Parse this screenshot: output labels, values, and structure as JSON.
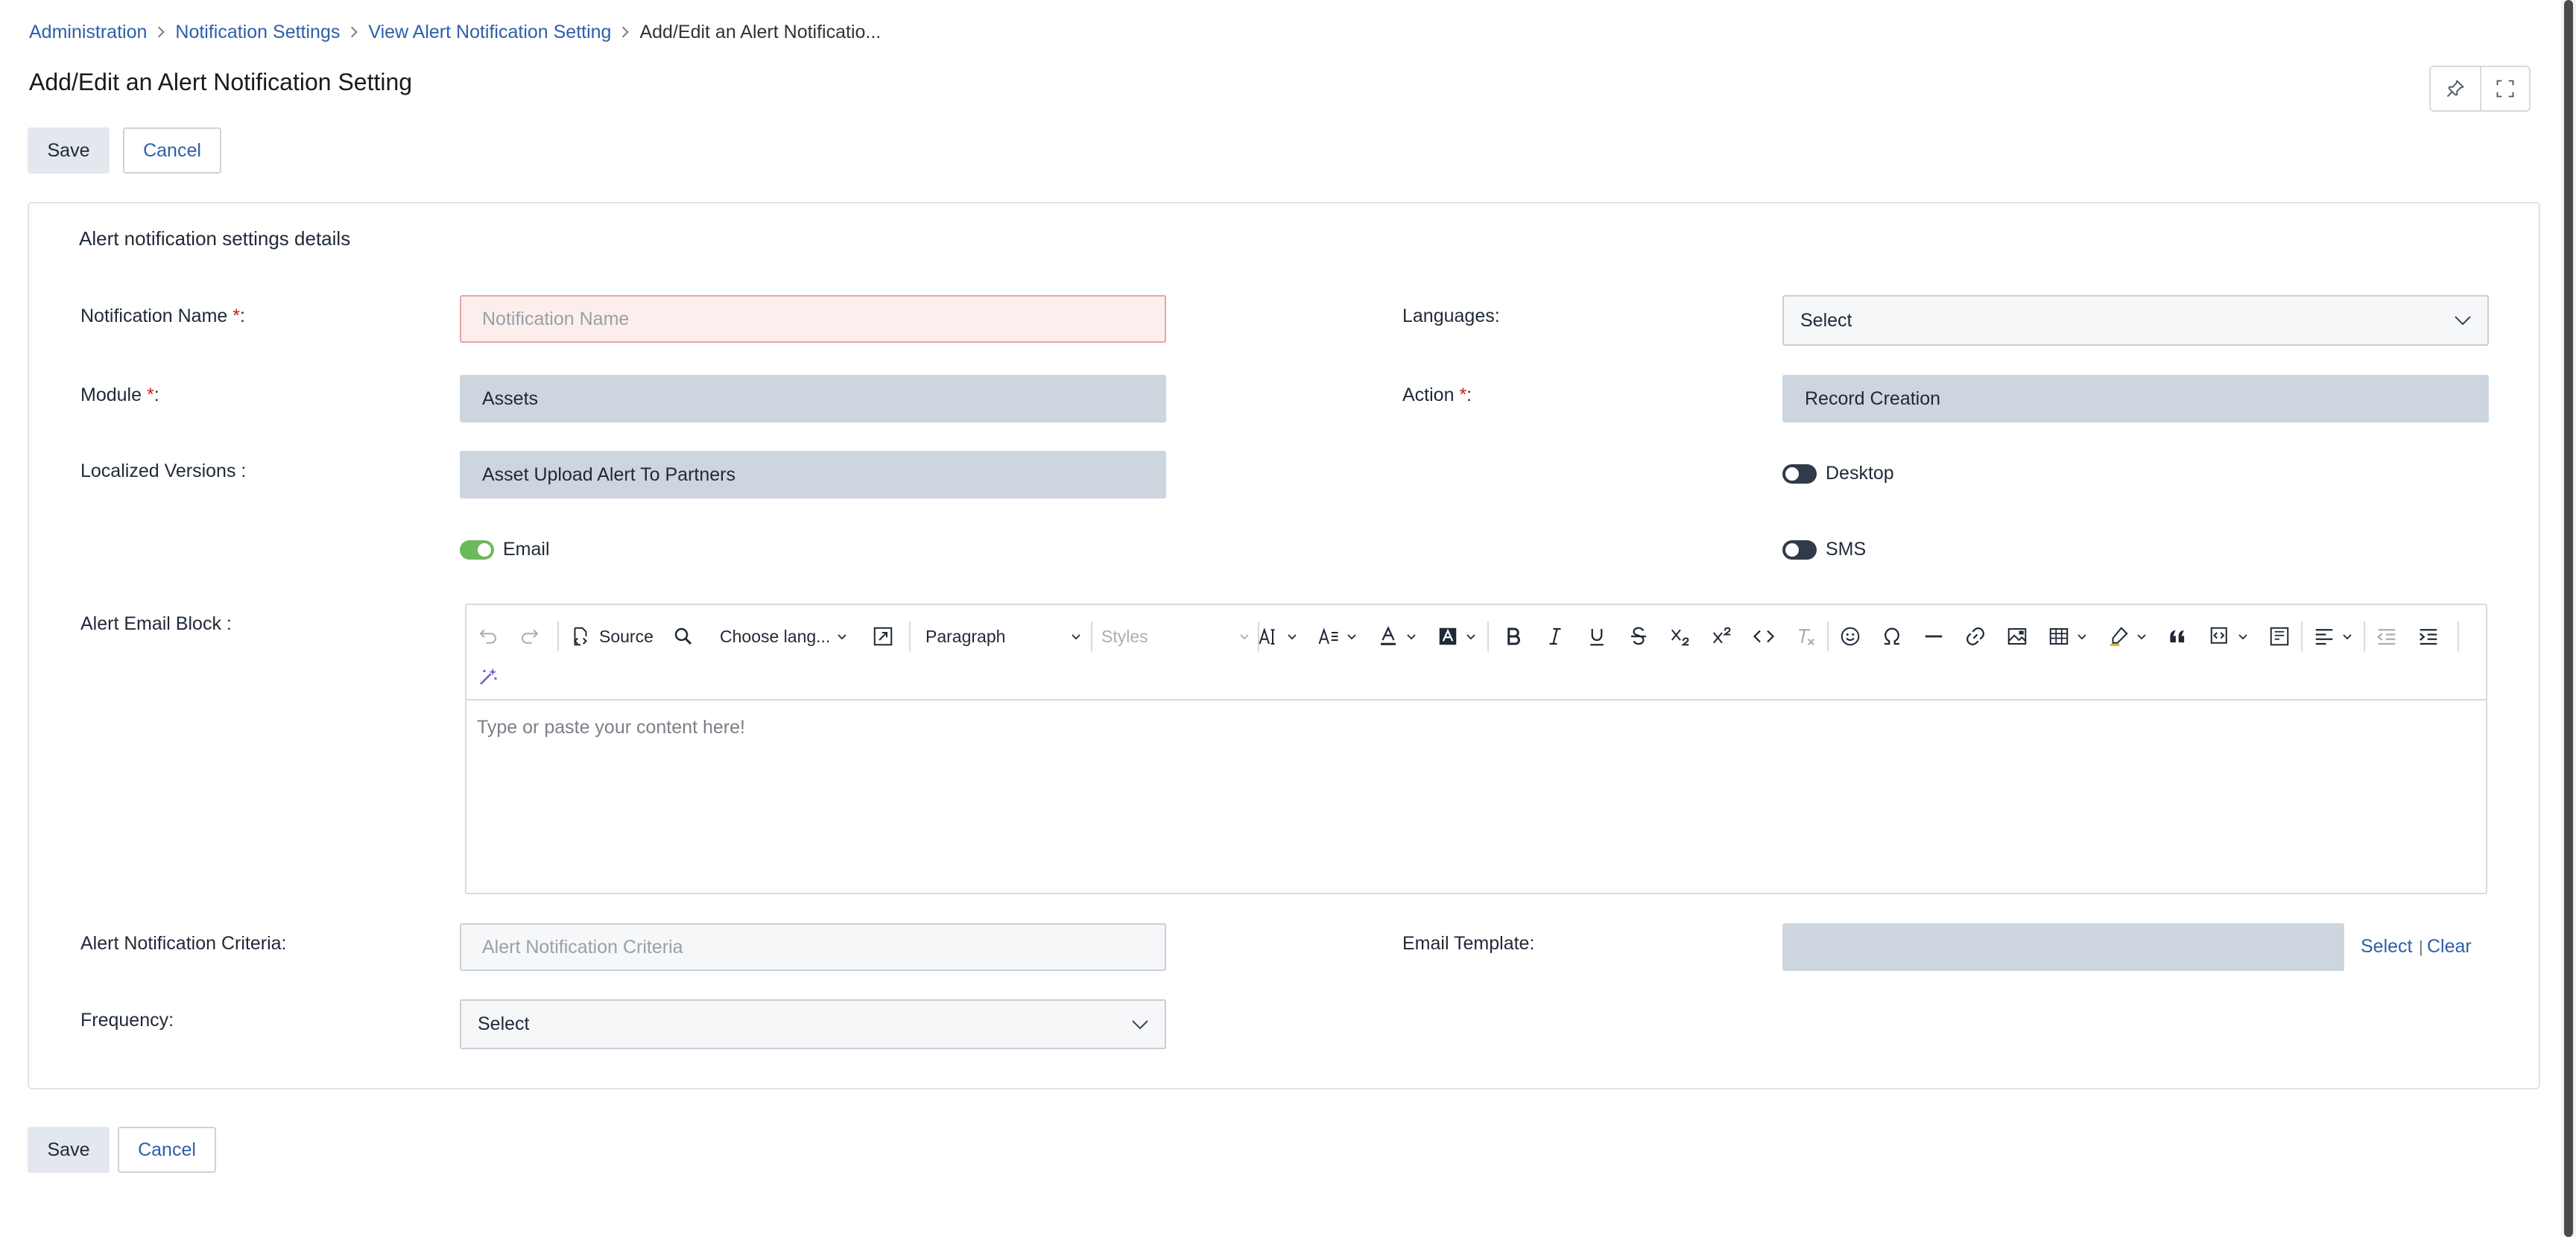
{
  "breadcrumb": {
    "items": [
      "Administration",
      "Notification Settings",
      "View Alert Notification Setting"
    ],
    "current": "Add/Edit an Alert Notificatio..."
  },
  "page": {
    "title": "Add/Edit an Alert Notification Setting"
  },
  "actions": {
    "save": "Save",
    "cancel": "Cancel"
  },
  "section": {
    "title": "Alert notification settings details"
  },
  "form": {
    "notification_name": {
      "label": "Notification Name ",
      "required": "*",
      "suffix": ":",
      "placeholder": "Notification Name"
    },
    "languages": {
      "label": "Languages:",
      "value": "Select"
    },
    "module": {
      "label": "Module ",
      "required": "*",
      "suffix": ":",
      "value": "Assets"
    },
    "action": {
      "label": "Action ",
      "required": "*",
      "suffix": ":",
      "value": "Record Creation"
    },
    "localized_versions": {
      "label": "Localized Versions :",
      "value": "Asset Upload Alert To Partners"
    },
    "toggles": {
      "email": {
        "label": "Email",
        "on": true
      },
      "desktop": {
        "label": "Desktop",
        "on": false
      },
      "sms": {
        "label": "SMS",
        "on": false
      }
    },
    "alert_email_block": {
      "label": "Alert Email Block :",
      "placeholder": "Type or paste your content here!"
    },
    "criteria": {
      "label": "Alert Notification Criteria:",
      "placeholder": "Alert Notification Criteria"
    },
    "email_template": {
      "label": "Email Template:",
      "select": "Select",
      "clear": "Clear",
      "pipe": "|"
    },
    "frequency": {
      "label": "Frequency:",
      "value": "Select"
    }
  },
  "editor_toolbar": {
    "source": "Source",
    "language": "Choose lang...",
    "paragraph": "Paragraph",
    "styles": "Styles"
  },
  "colors": {
    "link": "#2e5fa8",
    "toggle_on": "#6db85a",
    "toggle_off": "#2f3a4a",
    "required": "#d01b1b"
  }
}
